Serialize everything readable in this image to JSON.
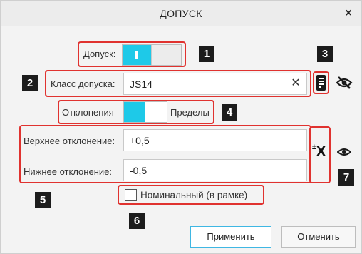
{
  "window": {
    "title": "ДОПУСК",
    "close_glyph": "×"
  },
  "tolerance": {
    "label": "Допуск:",
    "enabled": true
  },
  "tolerance_class": {
    "label": "Класс допуска:",
    "value": "JS14",
    "clear_glyph": "✕"
  },
  "mode": {
    "left_label": "Отклонения",
    "right_label": "Пределы",
    "selected": "Отклонения"
  },
  "deviations": {
    "upper_label": "Верхнее отклонение:",
    "upper_value": "+0,5",
    "lower_label": "Нижнее отклонение:",
    "lower_value": "-0,5",
    "symmetric_glyph": "±X"
  },
  "nominal": {
    "label": "Номинальный (в рамке)",
    "checked": false
  },
  "buttons": {
    "apply": "Применить",
    "cancel": "Отменить"
  },
  "annotations": [
    "1",
    "2",
    "3",
    "4",
    "5",
    "6",
    "7"
  ],
  "colors": {
    "accent": "#1ec9e8",
    "highlight": "#e0322f",
    "badge": "#1c1c1c"
  }
}
